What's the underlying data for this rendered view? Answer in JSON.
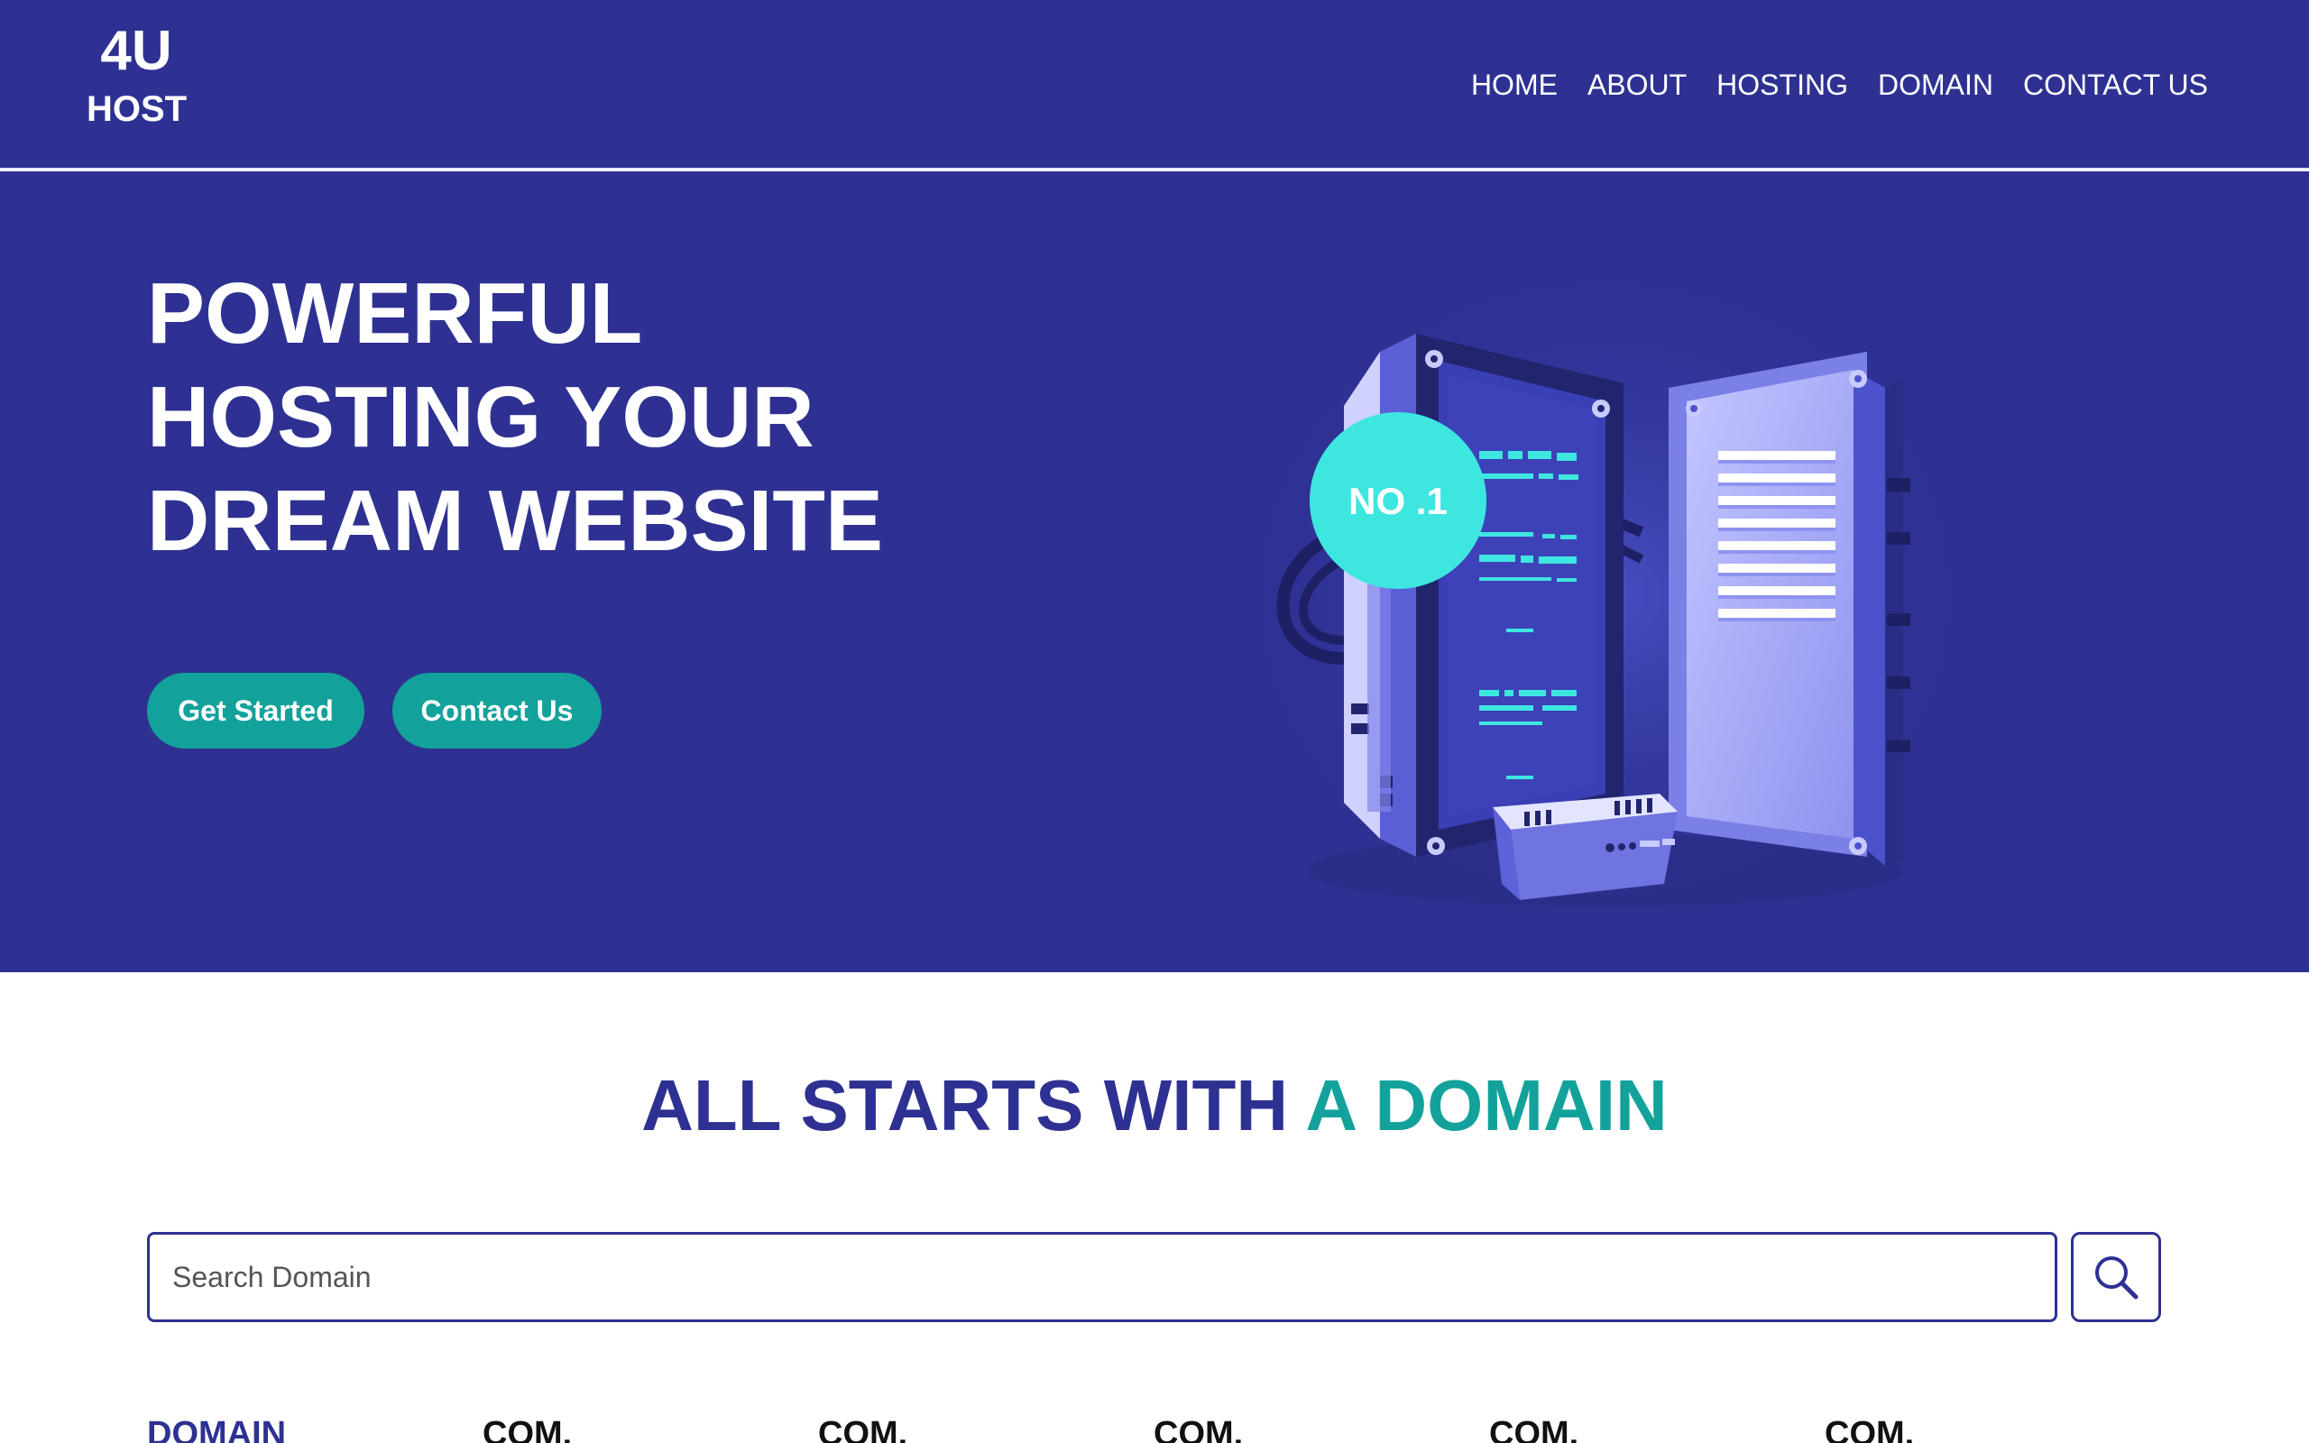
{
  "brand": {
    "line1": "4U",
    "line2": "HOST"
  },
  "nav": {
    "items": [
      {
        "label": "HOME"
      },
      {
        "label": "ABOUT"
      },
      {
        "label": "HOSTING"
      },
      {
        "label": "DOMAIN"
      },
      {
        "label": "CONTACT US"
      }
    ]
  },
  "hero": {
    "title_lines": [
      "POWERFUL",
      "HOSTING YOUR",
      "DREAM WEBSITE"
    ],
    "buttons": {
      "get_started": "Get Started",
      "contact": "Contact Us"
    },
    "badge": "NO .1"
  },
  "domain_section": {
    "title_part1": "ALL STARTS WITH",
    "title_part2": "A DOMAIN",
    "search": {
      "placeholder": "Search Domain",
      "button_icon": "search-icon"
    },
    "table_headers": [
      "DOMAIN",
      "COM.",
      "COM.",
      "COM.",
      "COM.",
      "COM."
    ]
  },
  "colors": {
    "primary": "#2e3192",
    "accent": "#13a29b",
    "badge": "#3ee6e0"
  }
}
